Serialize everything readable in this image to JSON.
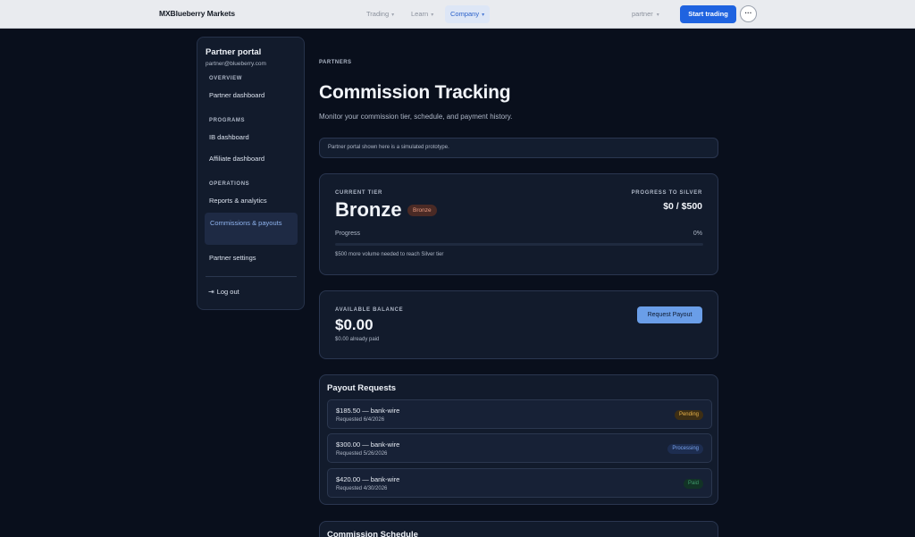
{
  "topnav": {
    "brand": "MXBlueberry Markets",
    "items": [
      {
        "label": "Trading",
        "chevron": "▾"
      },
      {
        "label": "Learn",
        "chevron": "▾"
      },
      {
        "label": "Company",
        "chevron": "▾"
      }
    ],
    "active_item": "Company",
    "partner_label": "partner",
    "partner_chevron": "▾",
    "start_trading": "Start trading",
    "more_glyph": "···"
  },
  "sidebar": {
    "title": "Partner portal",
    "email": "partner@blueberry.com",
    "sections": [
      {
        "heading": "OVERVIEW",
        "items": [
          "Partner dashboard"
        ]
      },
      {
        "heading": "PROGRAMS",
        "items": [
          "IB dashboard",
          "Affiliate dashboard"
        ]
      },
      {
        "heading": "OPERATIONS",
        "items": [
          "Reports & analytics",
          "Commissions & payouts",
          "Partner settings"
        ]
      }
    ],
    "active_item": "Commissions & payouts",
    "logout": "Log out",
    "logout_icon": "⇥"
  },
  "main": {
    "breadcrumb": "PARTNERS",
    "title": "Commission Tracking",
    "subtitle": "Monitor your commission tier, schedule, and payment history.",
    "notice": "Partner portal shown here is a simulated prototype."
  },
  "tier": {
    "label": "CURRENT TIER",
    "name": "Bronze",
    "badge": "Bronze",
    "progress_label_top": "PROGRESS TO SILVER",
    "progress_value": "$0 / $500",
    "progress_label": "Progress",
    "progress_pct_text": "0%",
    "progress_fraction": 0,
    "note": "$500 more volume needed to reach Silver tier"
  },
  "balance": {
    "label": "AVAILABLE BALANCE",
    "amount": "$0.00",
    "paid_note": "$0.00 already paid",
    "button": "Request Payout"
  },
  "payouts": {
    "title": "Payout Requests",
    "rows": [
      {
        "amount": "$185.50 — bank-wire",
        "date": "Requested 6/4/2026",
        "status": "Pending"
      },
      {
        "amount": "$300.00 — bank-wire",
        "date": "Requested 5/26/2026",
        "status": "Processing"
      },
      {
        "amount": "$420.00 — bank-wire",
        "date": "Requested 4/30/2026",
        "status": "Paid"
      }
    ]
  },
  "schedule": {
    "title": "Commission Schedule"
  },
  "colors": {
    "accent": "#1f63e0",
    "pending": "#e8b24a",
    "processing": "#79a4ee",
    "paid": "#3f9a6c",
    "bronze": "#e89a80"
  }
}
